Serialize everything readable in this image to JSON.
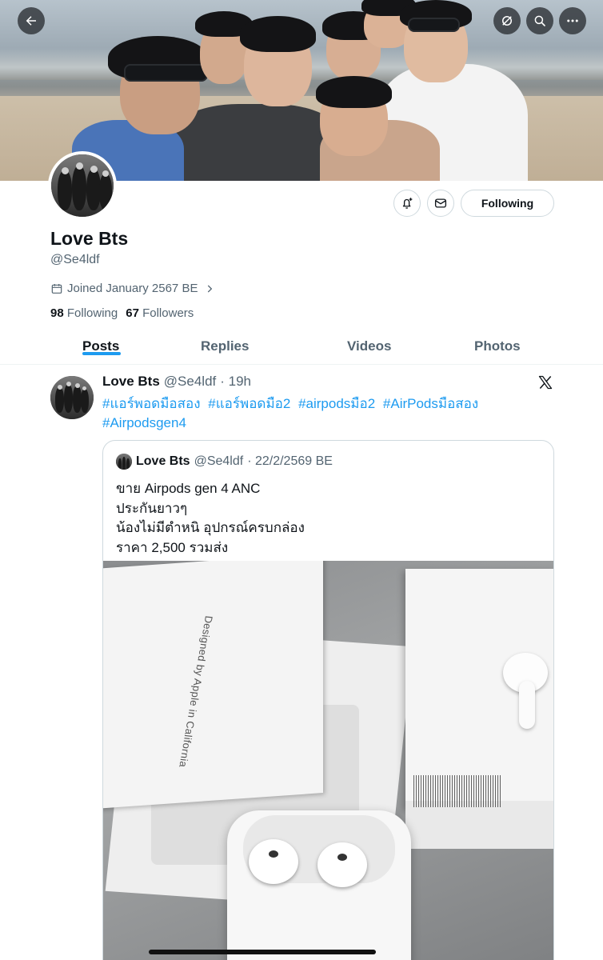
{
  "header": {
    "back_icon": "arrow-left-icon",
    "actions": [
      "grok-icon",
      "search-icon",
      "more-icon"
    ]
  },
  "profile": {
    "display_name": "Love Bts",
    "handle": "@Se4ldf",
    "joined": "Joined January 2567 BE",
    "following_count": "98",
    "following_label": "Following",
    "followers_count": "67",
    "followers_label": "Followers",
    "follow_button": "Following",
    "action_icons": [
      "notification-add-icon",
      "message-icon"
    ]
  },
  "tabs": [
    {
      "label": "Posts",
      "active": true
    },
    {
      "label": "Replies",
      "active": false
    },
    {
      "label": "Videos",
      "active": false
    },
    {
      "label": "Photos",
      "active": false
    }
  ],
  "post": {
    "author": "Love Bts",
    "handle": "@Se4ldf",
    "time": "· 19h",
    "hashtags": [
      "#แอร์พอดมือสอง",
      "#แอร์พอดมือ2",
      "#airpodsมือ2",
      "#AirPodsมือสอง",
      "#Airpodsgen4"
    ],
    "source_icon": "x-logo-icon",
    "quote": {
      "author": "Love Bts",
      "handle": "@Se4ldf",
      "date": "· 22/2/2569 BE",
      "lines": [
        "ขาย Airpods gen 4 ANC",
        "ประกันยาวๆ",
        "น้องไม่มีตำหนิ อุปกรณ์ครบกล่อง",
        "ราคา 2,500 รวมส่ง"
      ],
      "lid_text": "Designed by Apple in California"
    }
  },
  "colors": {
    "accent": "#1d9bf0",
    "text": "#0f1419",
    "secondary": "#536471",
    "border": "#cfd9de"
  }
}
